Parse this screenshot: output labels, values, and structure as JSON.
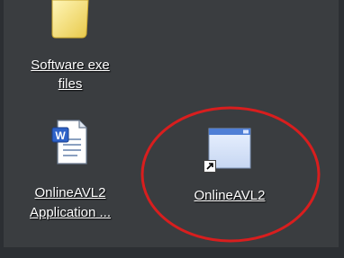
{
  "desktop": {
    "icons": [
      {
        "name": "Software exe",
        "name_line2": "files",
        "icon": "folder-icon"
      },
      {
        "name": "OnlineAVL2",
        "name_line2": "Application ...",
        "icon": "word-document-icon"
      },
      {
        "name": "OnlineAVL2",
        "icon": "application-window-icon",
        "shortcut": true
      }
    ]
  },
  "colors": {
    "desktop_background": "#3a3d40",
    "highlight_ellipse": "#d81e1e",
    "label_text": "#ffffff"
  }
}
